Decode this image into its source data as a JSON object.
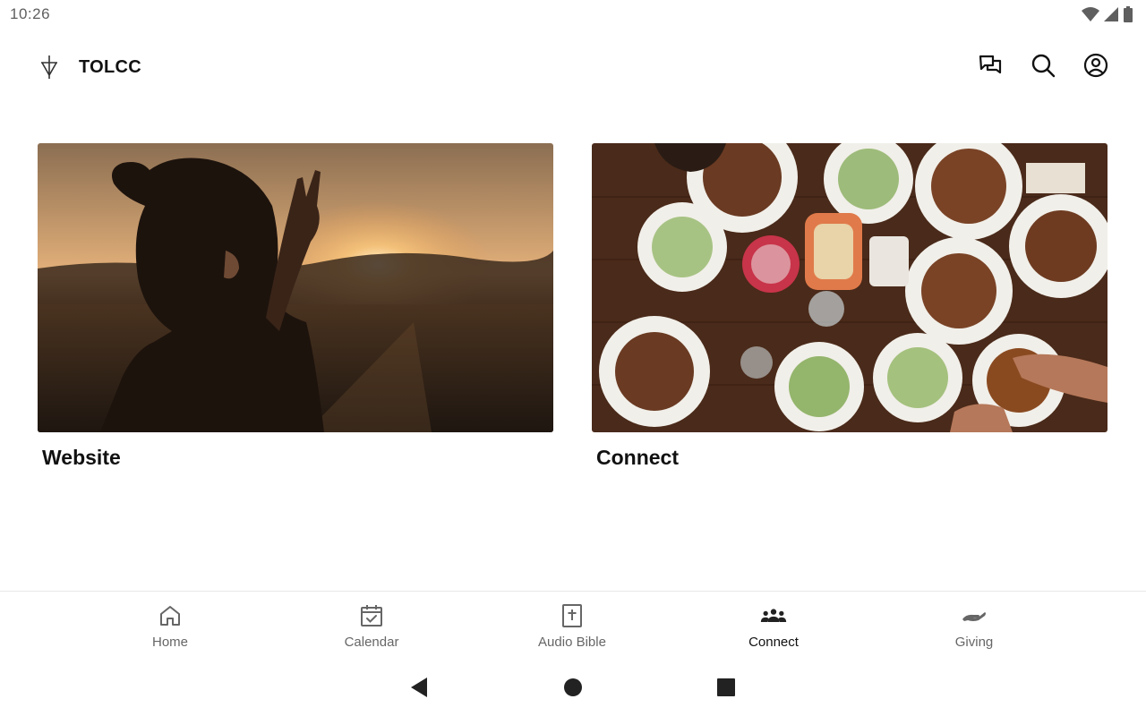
{
  "status_bar": {
    "time": "10:26"
  },
  "app_bar": {
    "title": "TOLCC",
    "logo_icon": "cross-logo-icon",
    "actions": [
      "chat-icon",
      "search-icon",
      "profile-icon"
    ]
  },
  "cards": [
    {
      "label": "Website",
      "image": "woman-sunset-photo"
    },
    {
      "label": "Connect",
      "image": "shared-meal-table-photo"
    }
  ],
  "bottom_nav": {
    "active": "Connect",
    "items": [
      {
        "label": "Home",
        "icon": "home-icon"
      },
      {
        "label": "Calendar",
        "icon": "calendar-check-icon"
      },
      {
        "label": "Audio Bible",
        "icon": "bible-icon"
      },
      {
        "label": "Connect",
        "icon": "group-icon"
      },
      {
        "label": "Giving",
        "icon": "giving-hands-icon"
      }
    ]
  },
  "colors": {
    "text": "#111111",
    "muted": "#666666",
    "divider": "#e8e8e8"
  }
}
